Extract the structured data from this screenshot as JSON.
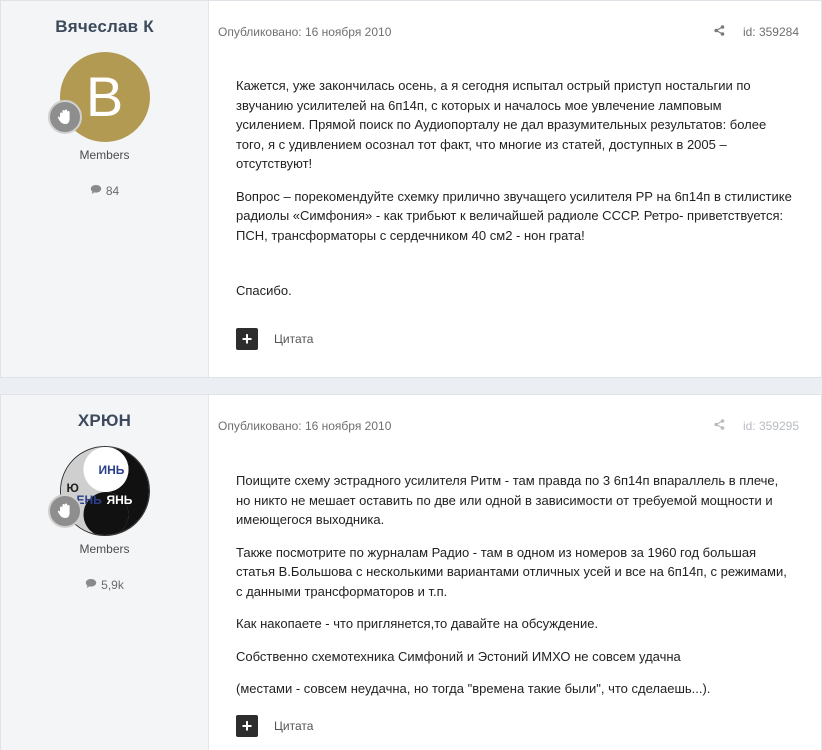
{
  "posts": [
    {
      "author": "Вячеслав К",
      "avatar_letter": "B",
      "avatar_color": "#b29a53",
      "group": "Members",
      "post_count": "84",
      "published": "Опубликовано: 16 ноября 2010",
      "id_label": "id: 359284",
      "paragraphs": [
        "Кажется, уже закончилась осень, а я сегодня испытал острый приступ ностальгии по звучанию усилителей на 6п14п, с которых и началось мое увлечение ламповым усилением. Прямой поиск по Аудиопорталу не дал вразумительных результатов: более того, я с удивлением осознал тот факт, что многие из статей, доступных в 2005 – отсутствуют!",
        "Вопрос – порекомендуйте схемку прилично звучащего усилителя РР на 6п14п в стилистике радиолы «Симфония» - как трибьют к величайшей радиоле СССР. Ретро- приветствуется: ПСН, трансформаторы с сердечником 40 см2 - нон грата!",
        "Спасибо."
      ],
      "quote_label": "Цитата"
    },
    {
      "author": "ХРЮН",
      "avatar_texts": [
        "ИНЬ",
        "Ю",
        "ЯНЬ",
        "ЕНЬ"
      ],
      "group": "Members",
      "post_count": "5,9k",
      "published": "Опубликовано: 16 ноября 2010",
      "id_label": "id: 359295",
      "paragraphs": [
        "Поищите схему эстрадного усилителя Ритм - там правда по 3 6п14п впараллель в плече, но никто не мешает оставить по две или одной в зависимости от требуемой мощности и имеющегося выходника.",
        "Также посмотрите по журналам Радио - там в одном из номеров за 1960 год большая статья В.Большова с несколькими вариантами отличных усей и все на 6п14п, с режимами, с данными трансформаторов и т.п.",
        "Как накопаете - что приглянется,то давайте на обсуждение.",
        "Собственно схемотехника Симфоний и Эстоний ИМХО не совсем удачна",
        "(местами - совсем неудачна, но тогда \"времена такие были\", что сделаешь...)."
      ],
      "quote_label": "Цитата"
    }
  ]
}
